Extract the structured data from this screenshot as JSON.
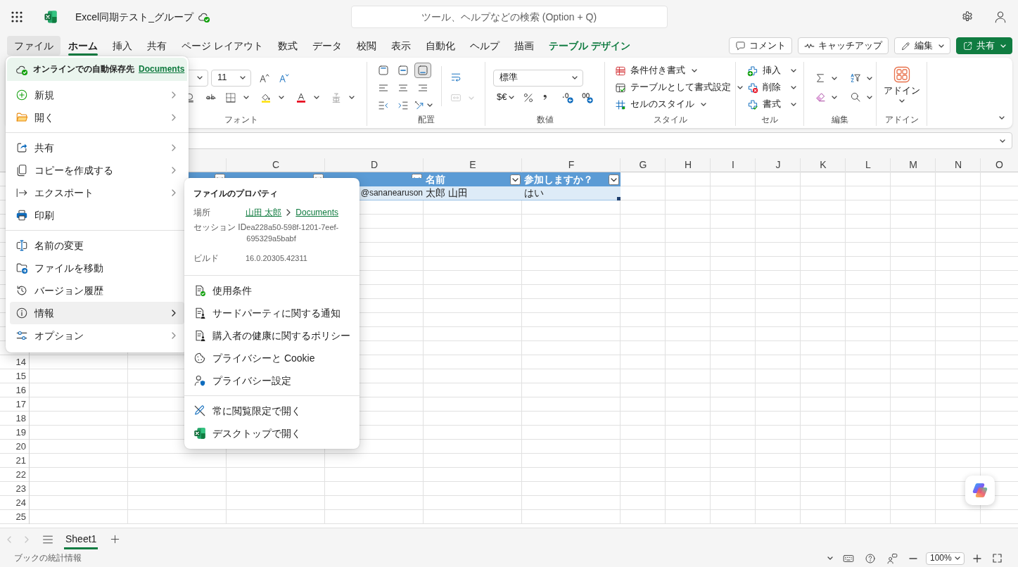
{
  "app": {
    "title": "Excel同期テスト_グループ",
    "search": {
      "placeholder": "ツール、ヘルプなどの検索 (Option + Q)"
    }
  },
  "tabs": [
    {
      "label": "ファイル",
      "kind": "standard",
      "selected": false,
      "expanded": true
    },
    {
      "label": "ホーム",
      "kind": "standard",
      "selected": true,
      "expanded": false
    },
    {
      "label": "挿入",
      "kind": "standard",
      "selected": false,
      "expanded": false
    },
    {
      "label": "共有",
      "kind": "standard",
      "selected": false,
      "expanded": false
    },
    {
      "label": "ページ レイアウト",
      "kind": "standard",
      "selected": false,
      "expanded": false
    },
    {
      "label": "数式",
      "kind": "standard",
      "selected": false,
      "expanded": false
    },
    {
      "label": "データ",
      "kind": "standard",
      "selected": false,
      "expanded": false
    },
    {
      "label": "校閲",
      "kind": "standard",
      "selected": false,
      "expanded": false
    },
    {
      "label": "表示",
      "kind": "standard",
      "selected": false,
      "expanded": false
    },
    {
      "label": "自動化",
      "kind": "standard",
      "selected": false,
      "expanded": false
    },
    {
      "label": "ヘルプ",
      "kind": "standard",
      "selected": false,
      "expanded": false
    },
    {
      "label": "描画",
      "kind": "standard",
      "selected": false,
      "expanded": false
    },
    {
      "label": "テーブル デザイン",
      "kind": "contextual",
      "selected": false,
      "expanded": false
    }
  ],
  "actions": [
    {
      "label": "コメント",
      "kind": "outline",
      "dropdown": false
    },
    {
      "label": "キャッチアップ",
      "kind": "outline",
      "dropdown": false
    },
    {
      "label": "編集",
      "kind": "outline",
      "dropdown": true
    },
    {
      "label": "共有",
      "kind": "primary",
      "dropdown": true
    }
  ],
  "ribbon": {
    "groups": [
      {
        "kind": "font",
        "label": "フォント",
        "font_size": "11"
      },
      {
        "kind": "alignment",
        "label": "配置",
        "vertical_align": [
          {
            "selected": false
          },
          {
            "selected": false
          },
          {
            "selected": true
          }
        ],
        "merge": {
          "disabled": true
        }
      },
      {
        "kind": "number",
        "label": "数値",
        "format": "標準",
        "currency": "$€"
      },
      {
        "kind": "styles",
        "label": "スタイル",
        "commands": [
          "条件付き書式",
          "テーブルとして書式設定",
          "セルのスタイル"
        ]
      },
      {
        "kind": "cells",
        "label": "セル",
        "commands": [
          "挿入",
          "削除",
          "書式"
        ]
      },
      {
        "kind": "editing",
        "label": "編集"
      },
      {
        "kind": "addins",
        "label": "アドイン",
        "button": "アドイン"
      }
    ]
  },
  "sheet": {
    "columns": [
      "C",
      "D",
      "E",
      "F",
      "G",
      "H",
      "I",
      "J",
      "K",
      "L",
      "M",
      "N",
      "O"
    ],
    "row_numbers": [
      "14",
      "15",
      "16",
      "17",
      "18",
      "19",
      "20",
      "21",
      "22",
      "23",
      "24",
      "25"
    ],
    "table": {
      "header": [
        {
          "filter": true
        },
        {
          "filter": true
        },
        {
          "filter": true
        },
        {
          "label": "名前",
          "filter": true
        },
        {
          "label": "参加しますか？",
          "filter": true
        }
      ],
      "rows": [
        [
          null,
          null,
          {
            "text": "@sananearuson",
            "cut_left": true
          },
          {
            "text": "太郎 山田",
            "cut_left": false
          },
          {
            "text": "はい",
            "cut_left": false
          }
        ]
      ]
    }
  },
  "sheet_nav": [
    {
      "disabled": true
    },
    {
      "disabled": true
    }
  ],
  "sheet_tabs": [
    {
      "label": "Sheet1",
      "selected": true
    }
  ],
  "status_bar": {
    "text": "ブックの統計情報",
    "zoom": "100%"
  },
  "file_menu": {
    "autosave": {
      "label": "オンラインでの自動保存先",
      "link": "Documents"
    },
    "sections": [
      {
        "items": [
          {
            "label": "新規",
            "submenu": true,
            "selected": false
          },
          {
            "label": "開く",
            "submenu": true,
            "selected": false
          }
        ]
      },
      {
        "items": [
          {
            "label": "共有",
            "submenu": true,
            "selected": false
          },
          {
            "label": "コピーを作成する",
            "submenu": true,
            "selected": false
          },
          {
            "label": "エクスポート",
            "submenu": true,
            "selected": false
          },
          {
            "label": "印刷",
            "submenu": false,
            "selected": false
          }
        ]
      },
      {
        "items": [
          {
            "label": "名前の変更",
            "submenu": false,
            "selected": false
          },
          {
            "label": "ファイルを移動",
            "submenu": false,
            "selected": false
          },
          {
            "label": "バージョン履歴",
            "submenu": false,
            "selected": false
          },
          {
            "label": "情報",
            "submenu": true,
            "selected": true
          },
          {
            "label": "オプション",
            "submenu": true,
            "selected": false
          }
        ]
      }
    ]
  },
  "info_panel": {
    "title": "ファイルのプロパティ",
    "properties": [
      {
        "label": "場所",
        "kind": "path",
        "parts": [
          "山田 太郎",
          "Documents"
        ]
      },
      {
        "label": "セッション ID",
        "kind": "text",
        "value": "ea228a50-598f-1201-7eef-695329a5babf"
      },
      {
        "label": "ビルド",
        "kind": "text",
        "value": "16.0.20305.42311"
      }
    ],
    "sections": [
      {
        "items": [
          "使用条件",
          "サードパーティに関する通知",
          "購入者の健康に関するポリシー",
          "プライバシーと Cookie",
          "プライバシー設定"
        ]
      },
      {
        "items": [
          "常に閲覧限定で開く",
          "デスクトップで開く"
        ]
      }
    ]
  }
}
